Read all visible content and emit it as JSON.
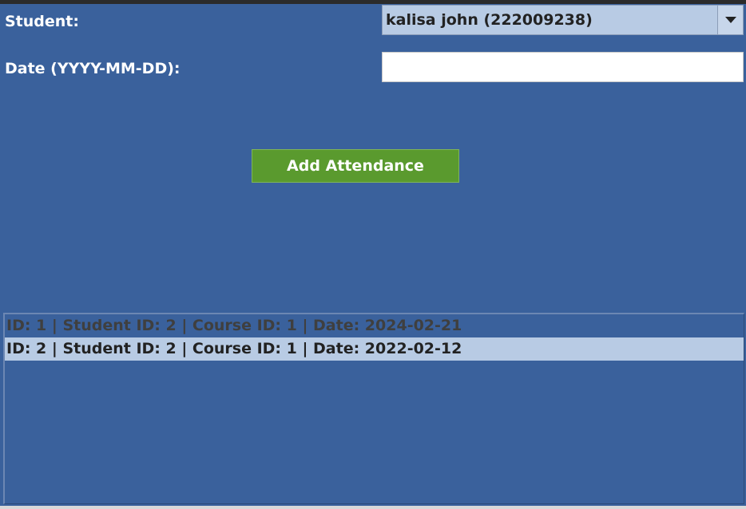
{
  "form": {
    "student_label": "Student:",
    "student_selected": "kalisa john (222009238)",
    "date_label": "Date (YYYY-MM-DD):",
    "date_value": ""
  },
  "actions": {
    "add_label": "Add Attendance"
  },
  "attendance_list": {
    "rows": [
      "ID: 1 | Student ID: 2 | Course ID: 1 | Date: 2024-02-21",
      "ID: 2 | Student ID: 2 | Course ID: 1 | Date: 2022-02-12"
    ],
    "selected_index": 1
  },
  "colors": {
    "panel_background": "#3a619c",
    "button_green": "#5a9a2e",
    "selection_highlight": "#b8cbe4"
  },
  "icons": {
    "dropdown": "chevron-down-icon"
  }
}
